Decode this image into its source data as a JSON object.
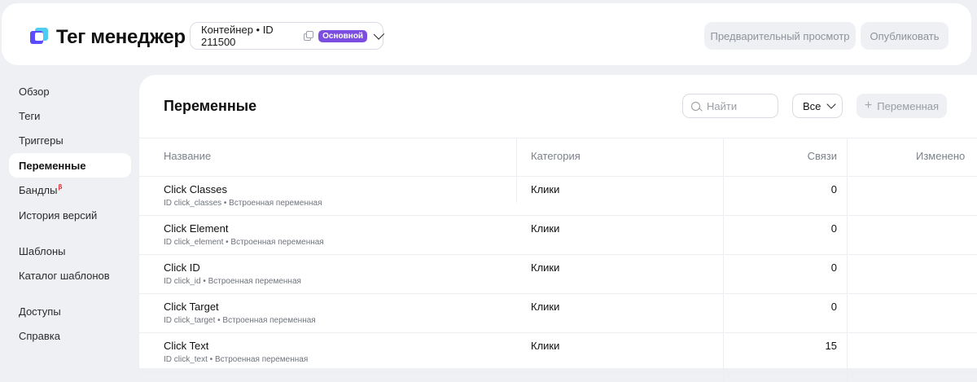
{
  "header": {
    "logo_text": "Тег менеджер",
    "container_label": "Контейнер • ID 211500",
    "container_badge": "Основной",
    "preview_label": "Предварительный просмотр",
    "publish_label": "Опубликовать",
    "accent_color": "#7b4de0"
  },
  "sidebar": {
    "items": [
      {
        "label": "Обзор"
      },
      {
        "label": "Теги"
      },
      {
        "label": "Триггеры"
      },
      {
        "label": "Переменные",
        "active": true
      },
      {
        "label": "Бандлы",
        "badge": "β"
      },
      {
        "label": "История версий"
      },
      {
        "label": "Шаблоны"
      },
      {
        "label": "Каталог шаблонов"
      },
      {
        "label": "Доступы"
      },
      {
        "label": "Справка"
      }
    ]
  },
  "main": {
    "title": "Переменные",
    "search_placeholder": "Найти",
    "filter_value": "Все",
    "add_label": "Переменная",
    "columns": [
      "Название",
      "Категория",
      "Связи",
      "Изменено"
    ],
    "rows": [
      {
        "name": "Click Classes",
        "sub": "ID click_classes • Встроенная переменная",
        "category": "Клики",
        "links": "0"
      },
      {
        "name": "Click Element",
        "sub": "ID click_element • Встроенная переменная",
        "category": "Клики",
        "links": "0"
      },
      {
        "name": "Click ID",
        "sub": "ID click_id • Встроенная переменная",
        "category": "Клики",
        "links": "0"
      },
      {
        "name": "Click Target",
        "sub": "ID click_target • Встроенная переменная",
        "category": "Клики",
        "links": "0"
      },
      {
        "name": "Click Text",
        "sub": "ID click_text • Встроенная переменная",
        "category": "Клики",
        "links": "15"
      }
    ]
  }
}
